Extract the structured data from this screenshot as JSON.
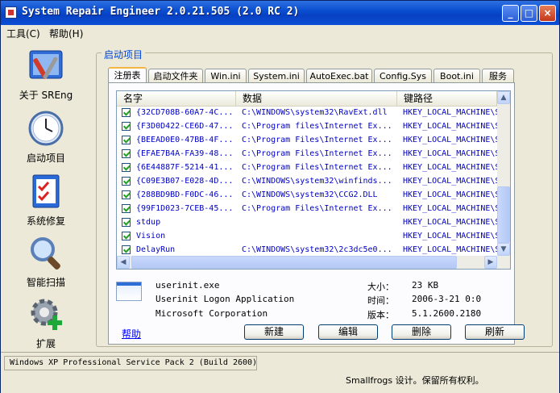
{
  "window": {
    "title": "System Repair Engineer 2.0.21.505 (2.0 RC 2)",
    "controls": {
      "minimize": "_",
      "maximize": "□",
      "close": "×"
    }
  },
  "menu": [
    "工具(C)",
    "帮助(H)"
  ],
  "sidebar": [
    {
      "label": "关于 SREng",
      "icon": "tools-icon"
    },
    {
      "label": "启动项目",
      "icon": "clock-icon",
      "active": true
    },
    {
      "label": "系统修复",
      "icon": "checklist-icon"
    },
    {
      "label": "智能扫描",
      "icon": "magnifier-icon"
    },
    {
      "label": "扩展",
      "icon": "gear-plus-icon"
    }
  ],
  "group_title": "启动项目",
  "tabs": [
    "注册表",
    "启动文件夹",
    "Win.ini",
    "System.ini",
    "AutoExec.bat",
    "Config.Sys",
    "Boot.ini",
    "服务"
  ],
  "active_tab": "注册表",
  "list": {
    "columns": [
      "名字",
      "数据",
      "键路径"
    ],
    "rows": [
      {
        "name": "{32CD708B-60A7-4C...",
        "data": "C:\\WINDOWS\\system32\\RavExt.dll",
        "path": "HKEY_LOCAL_MACHINE\\SOF",
        "checked": true
      },
      {
        "name": "{F3D0D422-CE6D-47...",
        "data": "C:\\Program files\\Internet Ex...",
        "path": "HKEY_LOCAL_MACHINE\\SOF",
        "checked": true
      },
      {
        "name": "{BEEAD0E0-47BB-4F...",
        "data": "C:\\Program Files\\Internet Ex...",
        "path": "HKEY_LOCAL_MACHINE\\SOF",
        "checked": true
      },
      {
        "name": "{EFAE7B4A-FA39-48...",
        "data": "C:\\Program Files\\Internet Ex...",
        "path": "HKEY_LOCAL_MACHINE\\SOF",
        "checked": true
      },
      {
        "name": "{6E44887F-5214-41...",
        "data": "C:\\Program Files\\Internet Ex...",
        "path": "HKEY_LOCAL_MACHINE\\SOF",
        "checked": true
      },
      {
        "name": "{C09E3B07-E028-4D...",
        "data": "C:\\WINDOWS\\system32\\winfinds...",
        "path": "HKEY_LOCAL_MACHINE\\SOF",
        "checked": true
      },
      {
        "name": "{288BD9BD-F0DC-46...",
        "data": "C:\\WINDOWS\\system32\\CCG2.DLL",
        "path": "HKEY_LOCAL_MACHINE\\SOF",
        "checked": true
      },
      {
        "name": "{99F1D023-7CEB-45...",
        "data": "C:\\Program Files\\Internet Ex...",
        "path": "HKEY_LOCAL_MACHINE\\SOF",
        "checked": true
      },
      {
        "name": "stdup",
        "data": "",
        "path": "HKEY_LOCAL_MACHINE\\SOF",
        "checked": true
      },
      {
        "name": "Vision",
        "data": "",
        "path": "HKEY_LOCAL_MACHINE\\SOF",
        "checked": true
      },
      {
        "name": "DelayRun",
        "data": "C:\\WINDOWS\\system32\\2c3dc5e0...",
        "path": "HKEY_LOCAL_MACHINE\\SOF",
        "checked": true
      }
    ]
  },
  "details": {
    "file": "userinit.exe",
    "description": "Userinit Logon Application",
    "company": "Microsoft Corporation",
    "size_label": "大小：",
    "size_value": "23 KB",
    "time_label": "时间：",
    "time_value": "2006-3-21 0:0",
    "version_label": "版本：",
    "version_value": "5.1.2600.2180"
  },
  "buttons": {
    "help": "帮助",
    "new": "新建",
    "edit": "编辑",
    "delete": "删除",
    "refresh": "刷新"
  },
  "status": {
    "os": "Windows XP Professional Service Pack 2 (Build 2600)",
    "copyright": "Smallfrogs 设计。保留所有权利。"
  }
}
